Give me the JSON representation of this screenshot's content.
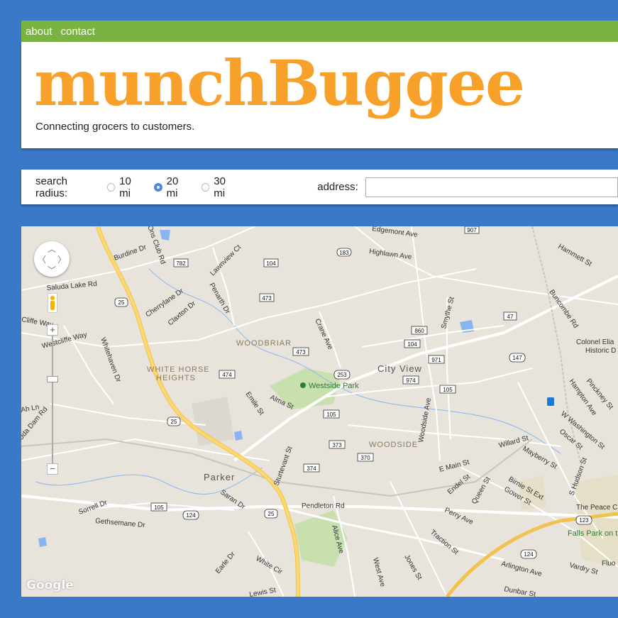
{
  "nav": {
    "about": "about",
    "contact": "contact"
  },
  "header": {
    "logo": "munchBuggee",
    "tagline": "Connecting grocers to customers."
  },
  "search": {
    "radius_label": "search radius:",
    "options": [
      "10 mi",
      "20 mi",
      "30 mi"
    ],
    "selected": "20 mi",
    "address_label": "address:",
    "address_value": ""
  },
  "map": {
    "attribution": "Google",
    "zoom_in": "+",
    "zoom_out": "−",
    "neighborhoods": [
      "WOODBRIAR",
      "WHITE HORSE",
      "HEIGHTS",
      "WOODSIDE"
    ],
    "cities": [
      "City View",
      "Parker"
    ],
    "parks": [
      "Westside Park",
      "Falls Park on t",
      "The Peace C",
      "Colonel Elia",
      "Historic D",
      "Fluo"
    ],
    "streets": [
      "Burdine Dr",
      "Lawnview Ct",
      "Penarth Dr",
      "Saluda Lake Rd",
      "Cherrylane Dr",
      "Claxton Dr",
      "Westcliffe Way",
      "Whitehaven Dr",
      "Crane Ave",
      "Emile St",
      "Alma St",
      "Highlawn Ave",
      "Edgemont Ave",
      "Smythe St",
      "Hammett St",
      "Buncombe Rd",
      "Hampton Ave",
      "Pinckney St",
      "W Washington St",
      "Oscar St",
      "Woodside Ave",
      "Willard St",
      "E Main St",
      "Endel St",
      "Queen St",
      "Mayberry St",
      "Birnie St Ext",
      "Gower St",
      "Perry Ave",
      "Traction St",
      "Arlington Ave",
      "Vardry St",
      "Dunbar St",
      "Sturtevant St",
      "Saran Dr",
      "Pendleton Rd",
      "Sorrell Dr",
      "Gethsemane Dr",
      "Alice Ave",
      "West Ave",
      "Jones St",
      "Earle Dr",
      "White Cir",
      "Lewis St",
      "Ons Club Rd",
      "S Hudson St",
      "Cliffe Way",
      "Ah Ln",
      "Uda Dam Rd"
    ],
    "route_shields": [
      "907",
      "183",
      "782",
      "104",
      "473",
      "25",
      "860",
      "104",
      "971",
      "974",
      "105",
      "47",
      "147",
      "253",
      "474",
      "105",
      "373",
      "370",
      "374",
      "25",
      "105",
      "124",
      "25",
      "124",
      "123",
      "473"
    ]
  }
}
